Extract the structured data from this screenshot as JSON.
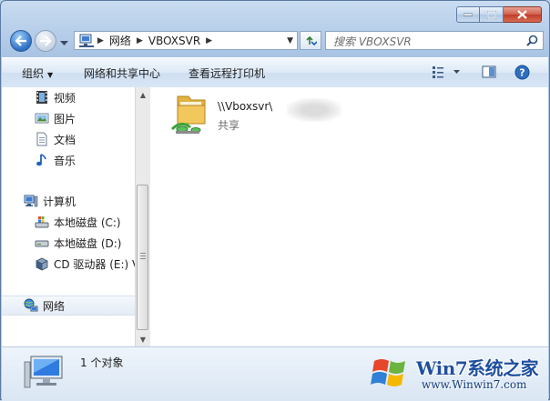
{
  "window": {
    "buttons": {
      "minimize": "minimize",
      "maximize": "maximize",
      "close": "close"
    }
  },
  "address_bar": {
    "crumbs": [
      "网络",
      "VBOXSVR"
    ]
  },
  "search": {
    "placeholder": "搜索 VBOXSVR"
  },
  "command_bar": {
    "organize": "组织",
    "network_center": "网络和共享中心",
    "remote_printers": "查看远程打印机"
  },
  "nav_pane": {
    "items": [
      {
        "label": "视频",
        "icon": "video-library-icon"
      },
      {
        "label": "图片",
        "icon": "pictures-library-icon"
      },
      {
        "label": "文档",
        "icon": "documents-library-icon"
      },
      {
        "label": "音乐",
        "icon": "music-library-icon"
      },
      {
        "label": "计算机",
        "icon": "computer-icon"
      },
      {
        "label": "本地磁盘 (C:)",
        "icon": "system-drive-icon"
      },
      {
        "label": "本地磁盘 (D:)",
        "icon": "drive-icon"
      },
      {
        "label": "CD 驱动器 (E:) V",
        "icon": "cd-drive-icon"
      },
      {
        "label": "网络",
        "icon": "network-icon",
        "selected": true
      }
    ]
  },
  "content": {
    "items": [
      {
        "name": "\\\\Vboxsvr\\",
        "type": "共享",
        "icon": "network-share-folder-icon"
      }
    ]
  },
  "details_pane": {
    "count_text": "1 个对象"
  },
  "watermark": {
    "line1": "Win7系统之家",
    "line2": "www.Winwin7.com"
  },
  "colors": {
    "accent": "#2d6fc2",
    "close": "#c13d28",
    "watermark_blue": "#1e4f9e",
    "watermark_orange": "#e07b12"
  }
}
